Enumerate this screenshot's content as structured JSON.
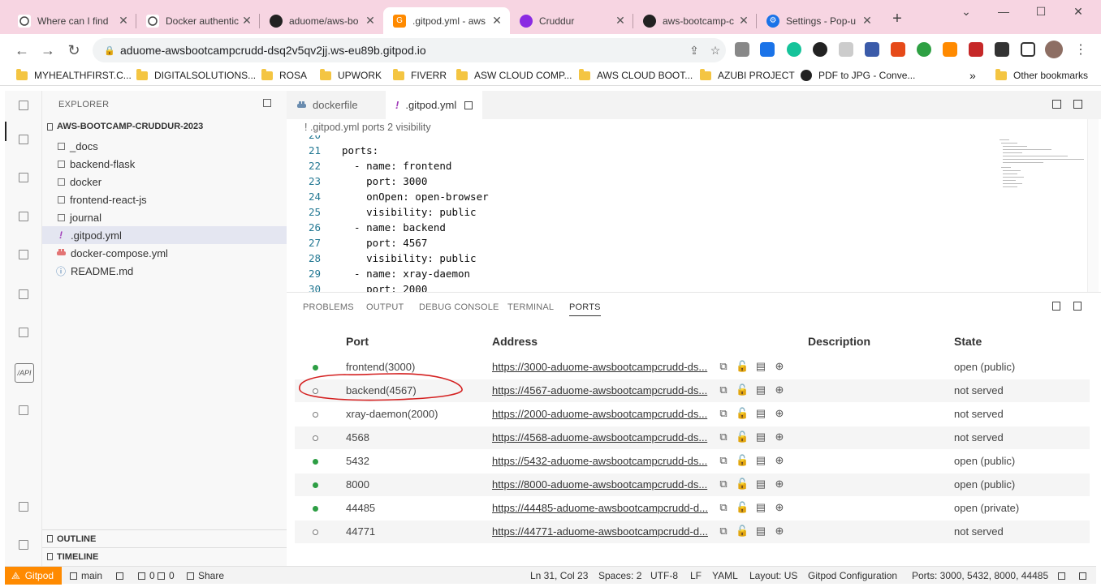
{
  "browser": {
    "tabs": [
      {
        "title": "Where can I find",
        "icon": "chatgpt-icon"
      },
      {
        "title": "Docker authentic",
        "icon": "chatgpt-icon"
      },
      {
        "title": "aduome/aws-bo",
        "icon": "github-icon"
      },
      {
        "title": ".gitpod.yml - aws",
        "icon": "gitpod-icon"
      },
      {
        "title": "Cruddur",
        "icon": "cruddur-icon"
      },
      {
        "title": "aws-bootcamp-c",
        "icon": "github-icon"
      },
      {
        "title": "Settings - Pop-u",
        "icon": "gear-icon"
      }
    ],
    "url": "aduome-awsbootcampcrudd-dsq2v5qv2jj.ws-eu89b.gitpod.io",
    "bookmarks": [
      "MYHEALTHFIRST.C...",
      "DIGITALSOLUTIONS...",
      "ROSA",
      "UPWORK",
      "FIVERR",
      "ASW CLOUD COMP...",
      "AWS CLOUD BOOT...",
      "AZUBI PROJECT",
      "PDF to JPG - Conve..."
    ],
    "bookmarks_more": "»",
    "other_bookmarks": "Other bookmarks"
  },
  "explorer": {
    "title": "EXPLORER",
    "root": "AWS-BOOTCAMP-CRUDDUR-2023",
    "folders": [
      "_docs",
      "backend-flask",
      "docker",
      "frontend-react-js",
      "journal"
    ],
    "files": [
      {
        "name": ".gitpod.yml",
        "icon": "!"
      },
      {
        "name": "docker-compose.yml",
        "icon": "docker"
      },
      {
        "name": "README.md",
        "icon": "ⓘ"
      }
    ],
    "outline": "OUTLINE",
    "timeline": "TIMELINE"
  },
  "editor": {
    "tabs": [
      {
        "label": "dockerfile",
        "active": false
      },
      {
        "label": ".gitpod.yml",
        "active": true
      }
    ],
    "breadcrumb": "! .gitpod.yml  ports  2  visibility",
    "lines": [
      {
        "num": "20",
        "text": ""
      },
      {
        "num": "21",
        "text": "ports:"
      },
      {
        "num": "22",
        "text": "  - name: frontend"
      },
      {
        "num": "23",
        "text": "    port: 3000"
      },
      {
        "num": "24",
        "text": "    onOpen: open-browser"
      },
      {
        "num": "25",
        "text": "    visibility: public"
      },
      {
        "num": "26",
        "text": "  - name: backend"
      },
      {
        "num": "27",
        "text": "    port: 4567"
      },
      {
        "num": "28",
        "text": "    visibility: public"
      },
      {
        "num": "29",
        "text": "  - name: xray-daemon"
      },
      {
        "num": "30",
        "text": "    port: 2000"
      }
    ]
  },
  "panel": {
    "tabs": [
      "PROBLEMS",
      "OUTPUT",
      "DEBUG CONSOLE",
      "TERMINAL",
      "PORTS"
    ],
    "active_tab": "PORTS",
    "columns": [
      "Port",
      "Address",
      "Description",
      "State"
    ],
    "rows": [
      {
        "port": "frontend(3000)",
        "address": "https://3000-aduome-awsbootcampcrudd-ds...",
        "state": "open (public)",
        "running": true
      },
      {
        "port": "backend(4567)",
        "address": "https://4567-aduome-awsbootcampcrudd-ds...",
        "state": "not served",
        "running": false
      },
      {
        "port": "xray-daemon(2000)",
        "address": "https://2000-aduome-awsbootcampcrudd-ds...",
        "state": "not served",
        "running": false
      },
      {
        "port": "4568",
        "address": "https://4568-aduome-awsbootcampcrudd-ds...",
        "state": "not served",
        "running": false
      },
      {
        "port": "5432",
        "address": "https://5432-aduome-awsbootcampcrudd-ds...",
        "state": "open (public)",
        "running": true
      },
      {
        "port": "8000",
        "address": "https://8000-aduome-awsbootcampcrudd-ds...",
        "state": "open (public)",
        "running": true
      },
      {
        "port": "44485",
        "address": "https://44485-aduome-awsbootcampcrudd-d...",
        "state": "open (private)",
        "running": true
      },
      {
        "port": "44771",
        "address": "https://44771-aduome-awsbootcampcrudd-d...",
        "state": "not served",
        "running": false
      }
    ]
  },
  "statusbar": {
    "gitpod": "Gitpod",
    "branch": "main",
    "errors": "0",
    "warnings": "0",
    "share": "Share",
    "position": "Ln 31, Col 23",
    "spaces": "Spaces: 2",
    "encoding": "UTF-8",
    "eol": "LF",
    "language": "YAML",
    "layout": "Layout: US",
    "config": "Gitpod Configuration",
    "ports": "Ports: 3000, 5432, 8000, 44485"
  },
  "colors": {
    "tabstrip": "#f7d5e2",
    "gitpod_orange": "#ff8a00",
    "running_dot": "#2d9e44",
    "annotation": "#d42020"
  }
}
